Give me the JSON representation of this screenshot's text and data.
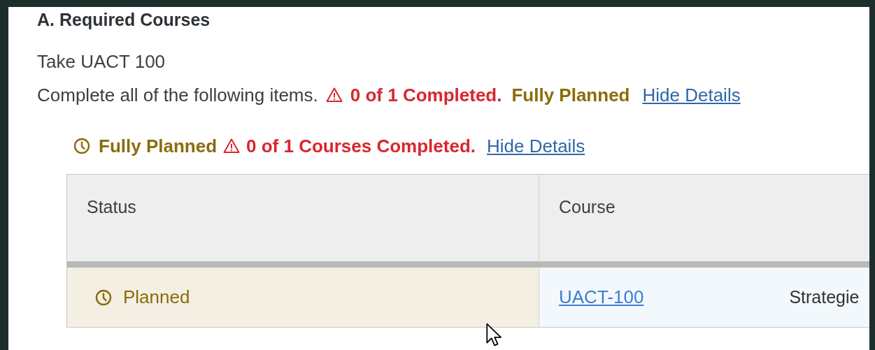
{
  "section": {
    "title": "A. Required Courses",
    "instruction": "Take UACT 100",
    "summary": {
      "text": "Complete all of the following items.",
      "progress": "0 of 1 Completed.",
      "plan_status": "Fully Planned",
      "toggle": "Hide Details"
    }
  },
  "requirement": {
    "plan_status": "Fully Planned",
    "progress": "0 of 1 Courses Completed.",
    "toggle": "Hide Details"
  },
  "table": {
    "columns": [
      "Status",
      "Course"
    ],
    "rows": [
      {
        "status": "Planned",
        "kind": "planned",
        "course": "UACT-100",
        "column_3": "Strategie"
      }
    ]
  }
}
